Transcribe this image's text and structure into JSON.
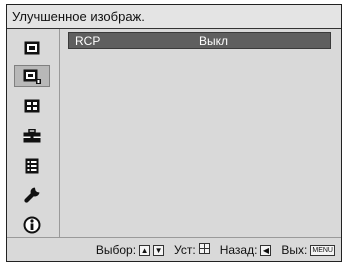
{
  "menu": {
    "title": "Улучшенное изображ."
  },
  "sidebar": {
    "icons": [
      {
        "name": "picture-icon"
      },
      {
        "name": "advanced-picture-icon",
        "selected": true
      },
      {
        "name": "screen-icon"
      },
      {
        "name": "setup-icon"
      },
      {
        "name": "function-icon"
      },
      {
        "name": "installation-icon"
      },
      {
        "name": "information-icon"
      }
    ]
  },
  "settings": {
    "rows": [
      {
        "label": "RCP",
        "value": "Выкл"
      }
    ]
  },
  "status": {
    "select_label": "Выбор:",
    "set_label": "Уст:",
    "back_label": "Назад:",
    "exit_label": "Вых:",
    "menu_key": "MENU"
  }
}
